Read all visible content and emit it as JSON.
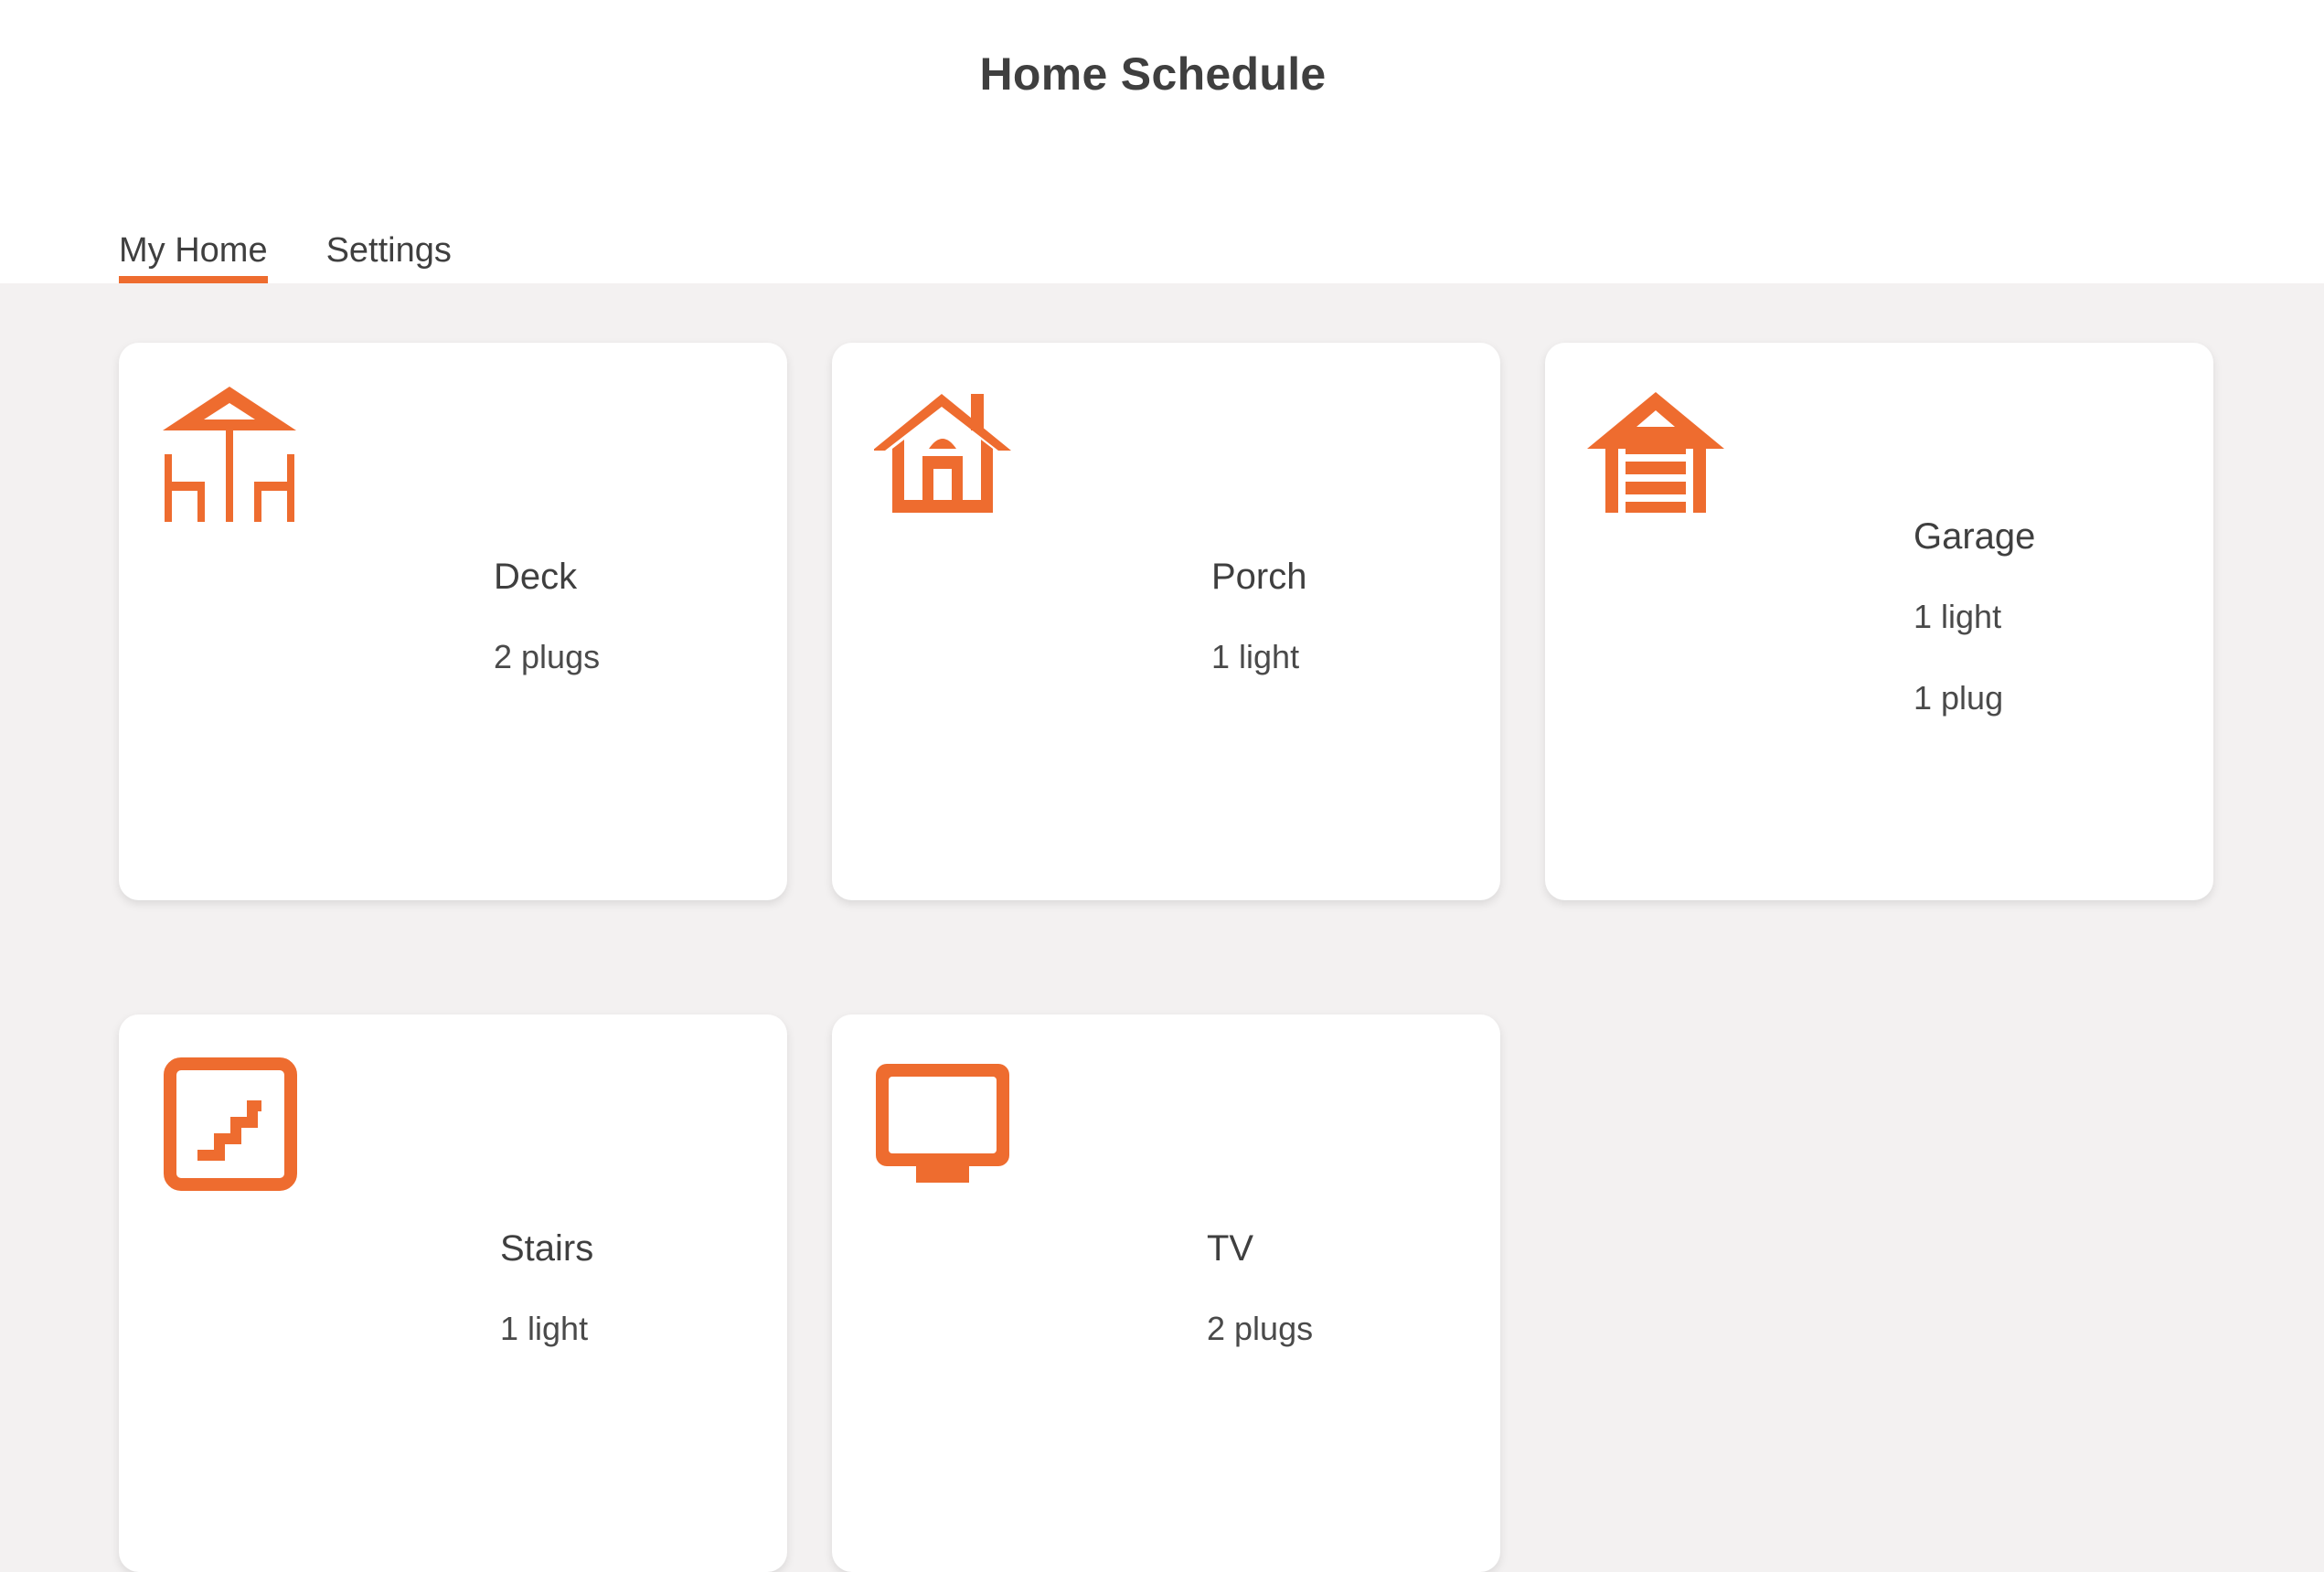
{
  "app": {
    "title": "Home Schedule"
  },
  "tabs": [
    {
      "label": "My Home",
      "active": true
    },
    {
      "label": "Settings",
      "active": false
    }
  ],
  "accent_color": "#ee6c2f",
  "rooms": [
    {
      "name": "Deck",
      "icon": "deck-icon",
      "devices": [
        "2 plugs"
      ]
    },
    {
      "name": "Porch",
      "icon": "porch-icon",
      "devices": [
        "1 light"
      ]
    },
    {
      "name": "Garage",
      "icon": "garage-icon",
      "devices": [
        "1 light",
        "1 plug"
      ]
    },
    {
      "name": "Stairs",
      "icon": "stairs-icon",
      "devices": [
        "1 light"
      ]
    },
    {
      "name": "TV",
      "icon": "tv-icon",
      "devices": [
        "2 plugs"
      ]
    }
  ]
}
